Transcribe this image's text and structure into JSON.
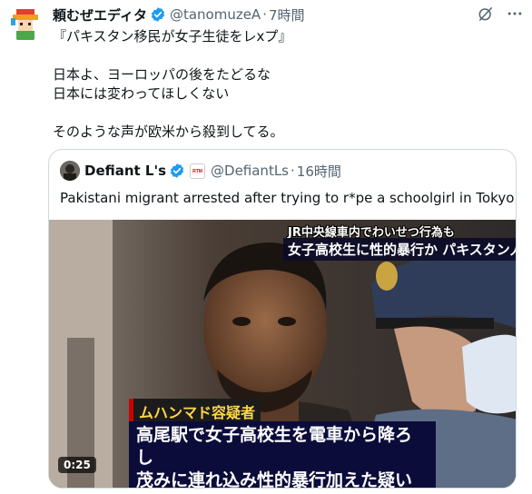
{
  "tweet": {
    "author_name": "頼むぜエディタ",
    "handle": "@tanomuzeA",
    "separator": "·",
    "time": "7時間",
    "lines": [
      "『パキスタン移民が女子生徒をレxプ』",
      "",
      "日本よ、ヨーロッパの後をたどるな",
      "日本には変わってほしくない",
      "",
      "そのような声が欧米から殺到してる。"
    ],
    "icons": [
      "verified-badge-icon",
      "grok-icon",
      "more-icon"
    ]
  },
  "quote": {
    "author_name": "Defiant L's",
    "affiliate_badge_text": "RTM",
    "handle": "@DefiantLs",
    "separator": "·",
    "time": "16時間",
    "text": "Pakistani migrant arrested after trying to r*pe a schoolgirl in Tokyo",
    "video": {
      "caption_top_small": "JR中央線車内でわいせつ行為も",
      "caption_top_big": "女子高校生に性的暴行か パキスタン人男逮捕",
      "caption_name": "ムハンマド容疑者",
      "caption_main_line1": "高尾駅で女子高校生を電車から降ろし",
      "caption_main_line2": "茂みに連れ込み性的暴行加えた疑い",
      "duration": "0:25"
    }
  },
  "colors": {
    "verified_blue": "#1d9bf0",
    "secondary_text": "#536471",
    "caption_bg": "#0b0c3a",
    "name_caption_yellow": "#ffd64a"
  }
}
